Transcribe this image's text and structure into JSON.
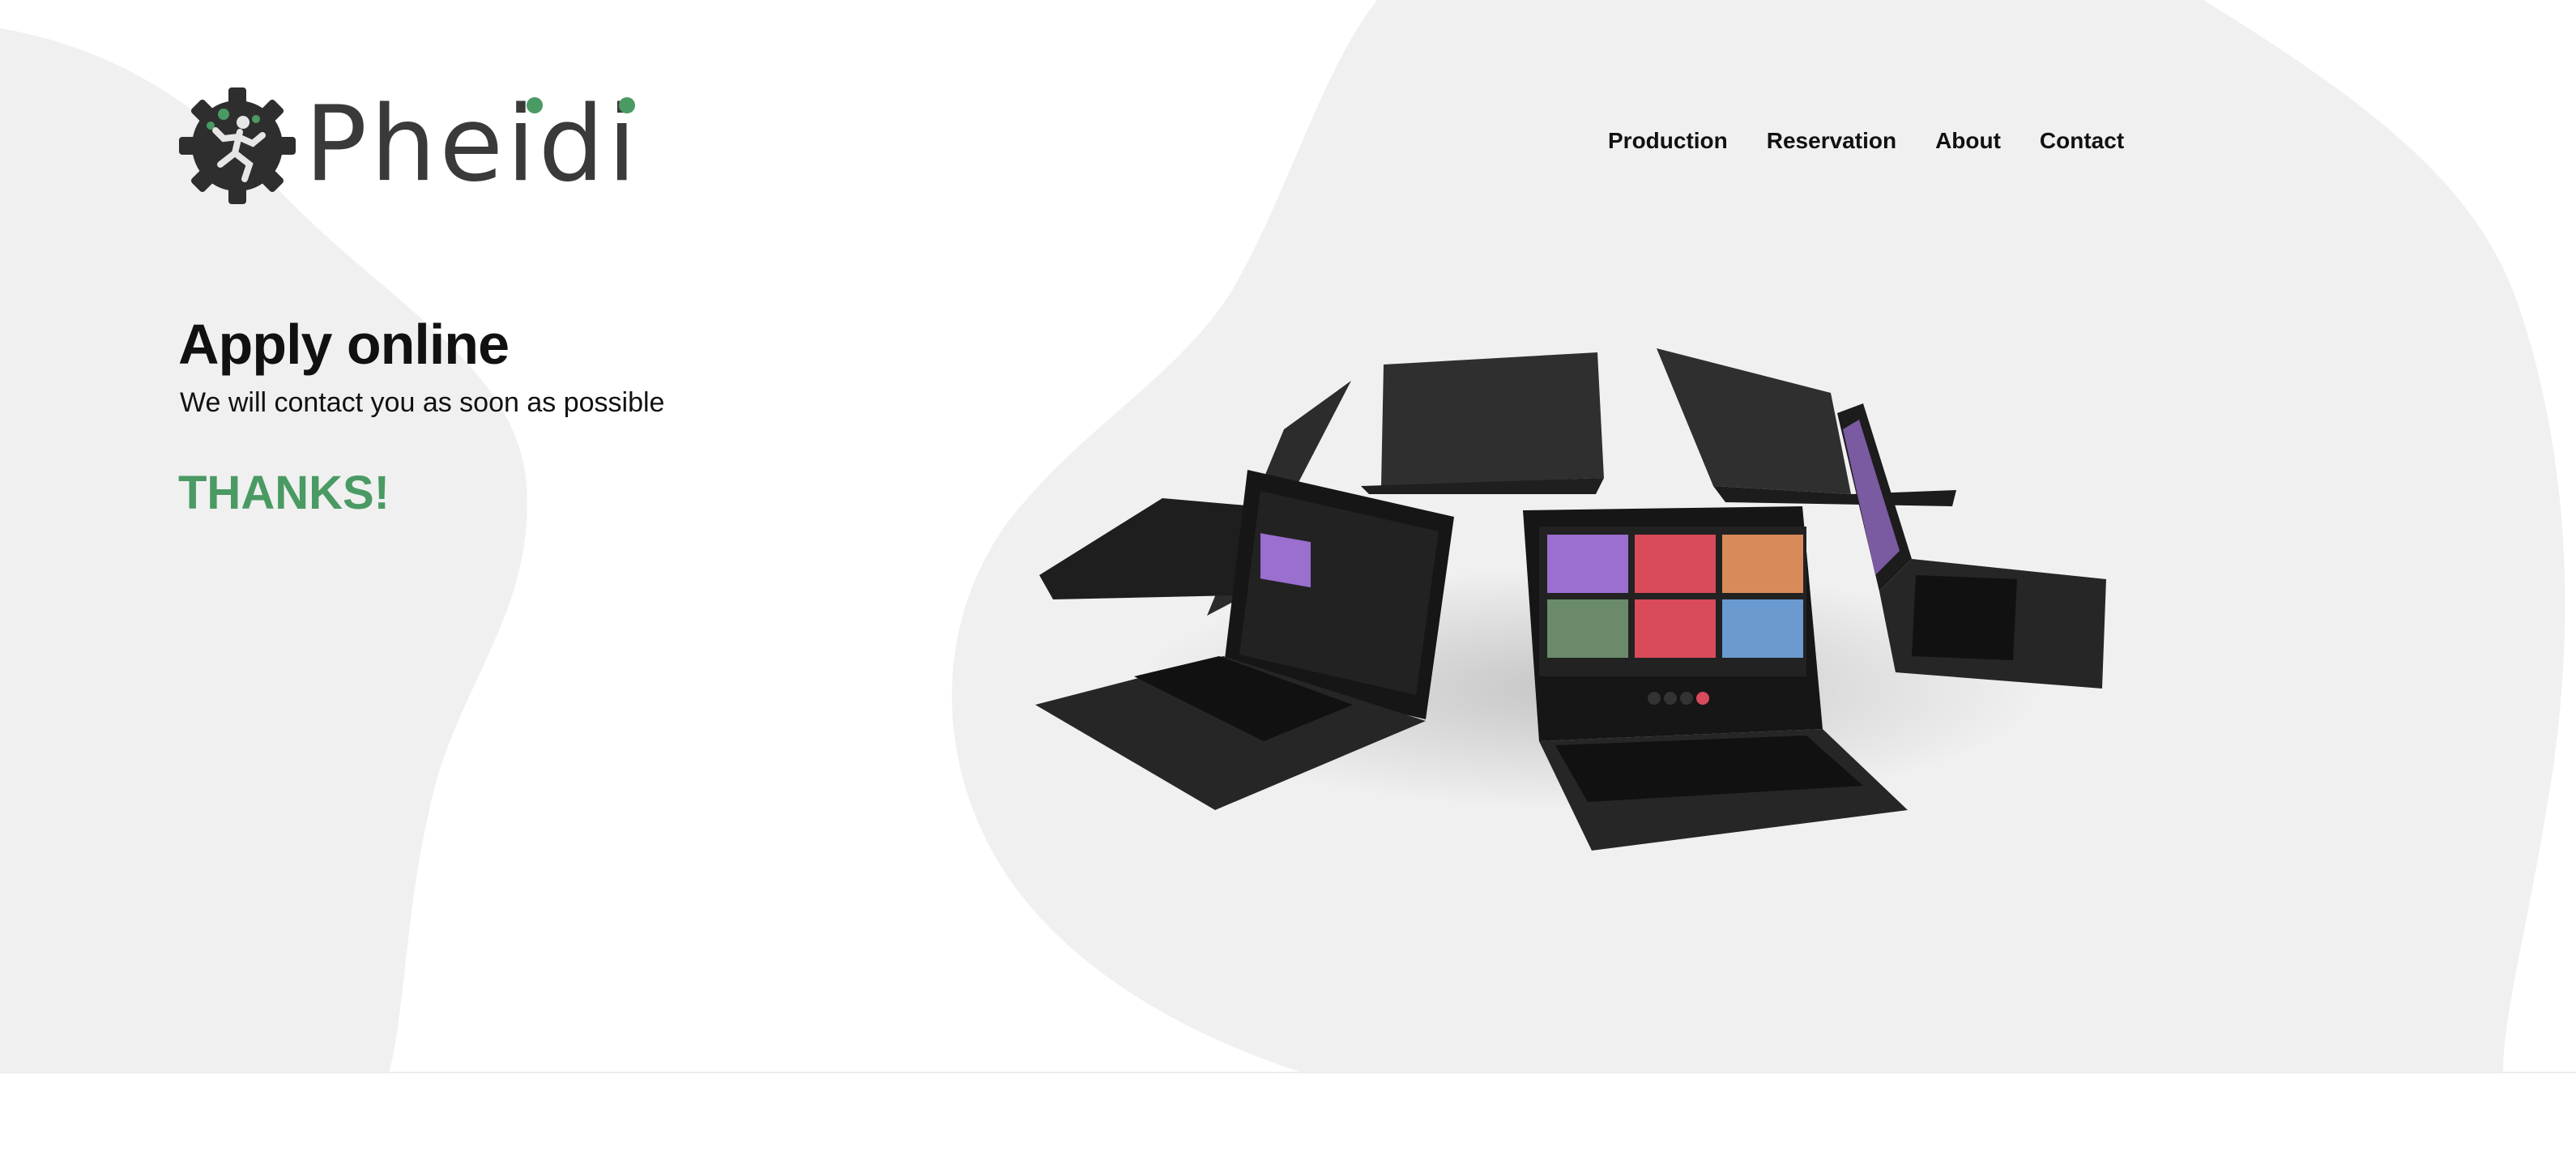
{
  "brand": {
    "name": "Pheidi",
    "logo_icon": "gear-runner-icon",
    "accent": "#4a9a63",
    "text_color": "#3a3a3a"
  },
  "nav": {
    "items": [
      {
        "label": "Production"
      },
      {
        "label": "Reservation"
      },
      {
        "label": "About"
      },
      {
        "label": "Contact"
      }
    ]
  },
  "hero": {
    "title": "Apply online",
    "subtitle": "We will contact you as soon as possible",
    "thanks": "THANKS!",
    "image_icon": "laptops-video-call-illustration"
  },
  "colors": {
    "background": "#ffffff",
    "blob": "#f0f0f0",
    "thanks": "#4a9a63"
  }
}
